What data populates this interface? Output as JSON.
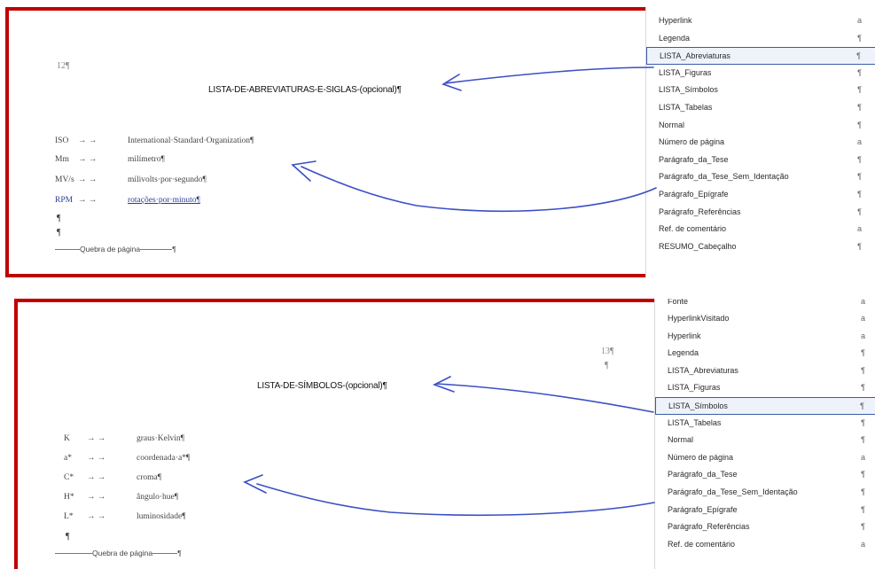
{
  "panel1": {
    "page_number": "12¶",
    "heading": "LISTA-DE-ABREVIATURAS-E-SIGLAS-(opcional)¶",
    "entries": [
      {
        "abbr": "ISO",
        "tabs": "→ → ",
        "text": "International·Standard·Organization¶"
      },
      {
        "abbr": "Mm",
        "tabs": "→ → ",
        "text": "milímetro¶"
      },
      {
        "abbr": "MV/s",
        "tabs": "→ → ",
        "text": "milivolts·por·segundo¶"
      },
      {
        "abbr": "RPM",
        "tabs": "→ → ",
        "text": "rotações·por·minuto¶"
      }
    ],
    "empty_paras": [
      "¶",
      "¶"
    ],
    "page_break": "Quebra de página",
    "page_break_end": "¶",
    "styles": [
      {
        "name": "Hyperlink",
        "mark": "a"
      },
      {
        "name": "Legenda",
        "mark": "¶"
      },
      {
        "name": "LISTA_Abreviaturas",
        "mark": "¶"
      },
      {
        "name": "LISTA_Figuras",
        "mark": "¶"
      },
      {
        "name": "LISTA_Símbolos",
        "mark": "¶"
      },
      {
        "name": "LISTA_Tabelas",
        "mark": "¶"
      },
      {
        "name": "Normal",
        "mark": "¶"
      },
      {
        "name": "Número de página",
        "mark": "a"
      },
      {
        "name": "Parágrafo_da_Tese",
        "mark": "¶"
      },
      {
        "name": "Parágrafo_da_Tese_Sem_Identação",
        "mark": "¶"
      },
      {
        "name": "Parágrafo_Epígrafe",
        "mark": "¶"
      },
      {
        "name": "Parágrafo_Referências",
        "mark": "¶"
      },
      {
        "name": "Ref. de comentário",
        "mark": "a"
      },
      {
        "name": "RESUMO_Cabeçalho",
        "mark": "¶"
      }
    ],
    "selected_style": "LISTA_Abreviaturas"
  },
  "panel2": {
    "page_number": "13¶",
    "page_number_para": "¶",
    "heading": "LISTA-DE-SÍMBOLOS-(opcional)¶",
    "entries": [
      {
        "abbr": "K",
        "tabs": "→ → ",
        "text": "graus·Kelvin¶"
      },
      {
        "abbr": "a*",
        "tabs": "→ → ",
        "text": "coordenada·a*¶"
      },
      {
        "abbr": "C*",
        "tabs": "→ → ",
        "text": "croma¶"
      },
      {
        "abbr": "H*",
        "tabs": "→ → ",
        "text": "ângulo·hue¶"
      },
      {
        "abbr": "L*",
        "tabs": "→ → ",
        "text": "luminosidade¶"
      }
    ],
    "empty_paras": [
      "¶"
    ],
    "page_break": "Quebra de página",
    "page_break_end": "¶",
    "styles": [
      {
        "name": "Fonte",
        "mark": "a"
      },
      {
        "name": "HyperlinkVisitado",
        "mark": "a"
      },
      {
        "name": "Hyperlink",
        "mark": "a"
      },
      {
        "name": "Legenda",
        "mark": "¶"
      },
      {
        "name": "LISTA_Abreviaturas",
        "mark": "¶"
      },
      {
        "name": "LISTA_Figuras",
        "mark": "¶"
      },
      {
        "name": "LISTA_Símbolos",
        "mark": "¶"
      },
      {
        "name": "LISTA_Tabelas",
        "mark": "¶"
      },
      {
        "name": "Normal",
        "mark": "¶"
      },
      {
        "name": "Número de página",
        "mark": "a"
      },
      {
        "name": "Parágrafo_da_Tese",
        "mark": "¶"
      },
      {
        "name": "Parágrafo_da_Tese_Sem_Identação",
        "mark": "¶"
      },
      {
        "name": "Parágrafo_Epígrafe",
        "mark": "¶"
      },
      {
        "name": "Parágrafo_Referências",
        "mark": "¶"
      },
      {
        "name": "Ref. de comentário",
        "mark": "a"
      }
    ],
    "selected_style": "LISTA_Símbolos"
  },
  "colors": {
    "frame": "#c00000",
    "arrow": "#3b4fc4",
    "selection": "#3b5ba7"
  }
}
